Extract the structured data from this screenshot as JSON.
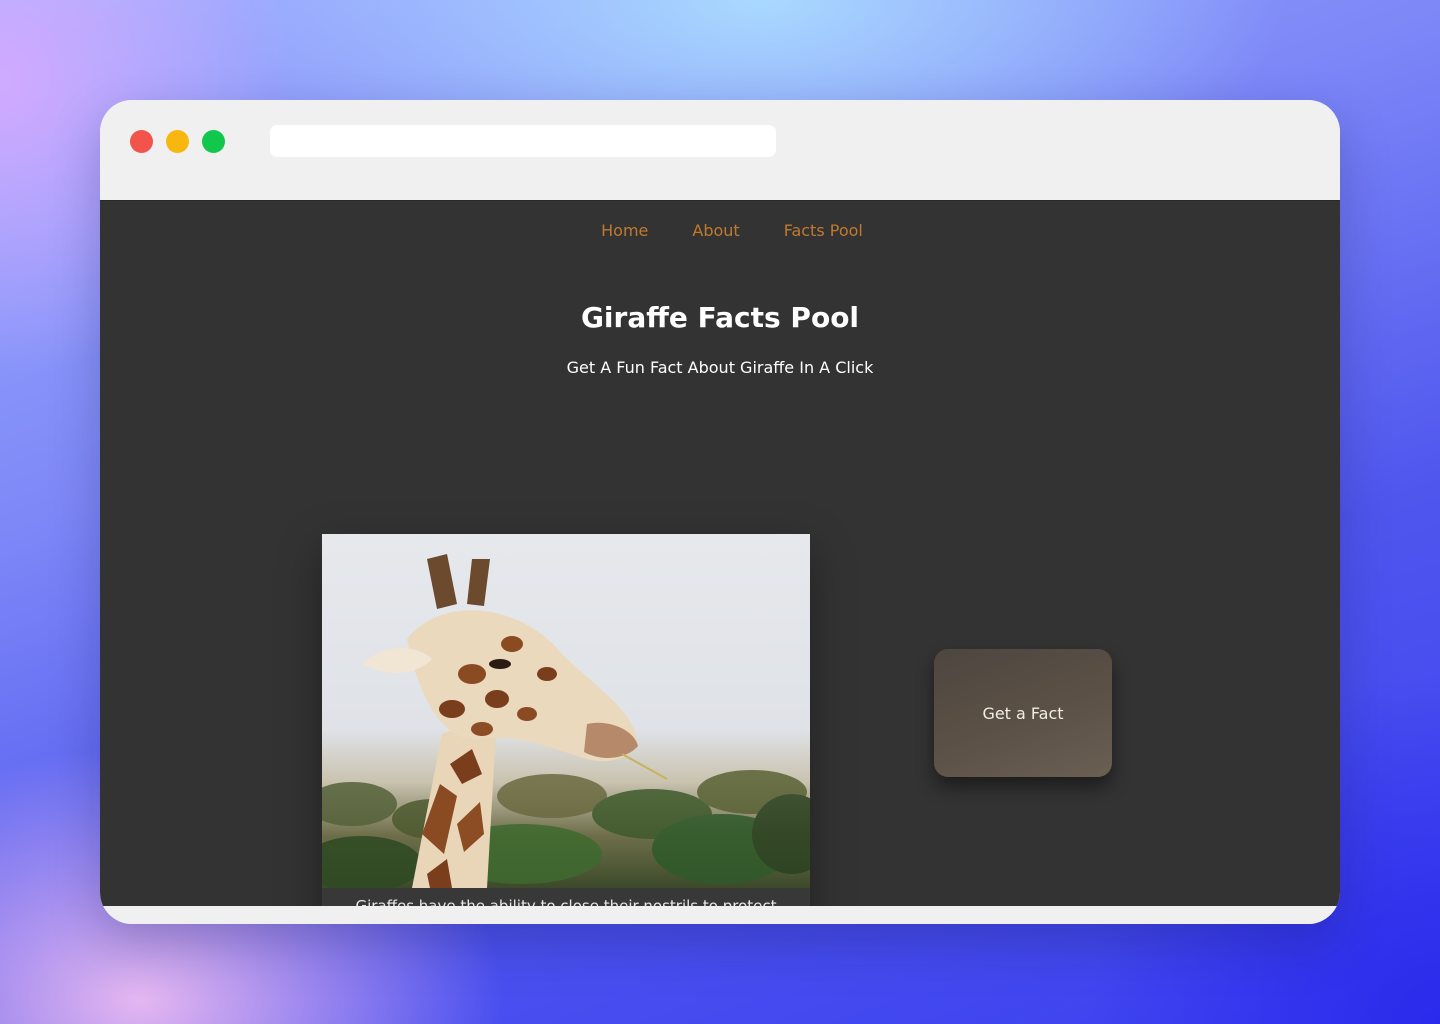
{
  "nav": {
    "home": "Home",
    "about": "About",
    "facts_pool": "Facts Pool"
  },
  "header": {
    "title": "Giraffe Facts Pool",
    "subtitle": "Get A Fun Fact About Giraffe In A Click"
  },
  "fact_card": {
    "caption": "Giraffes have the ability to close their nostrils to protect against sandstorms and ants."
  },
  "actions": {
    "get_fact_label": "Get a Fact"
  },
  "colors": {
    "nav_link": "#c07a2e",
    "page_background": "#333333",
    "window_close": "#f2544c",
    "window_minimize": "#f8b70f",
    "window_maximize": "#12c84c"
  }
}
